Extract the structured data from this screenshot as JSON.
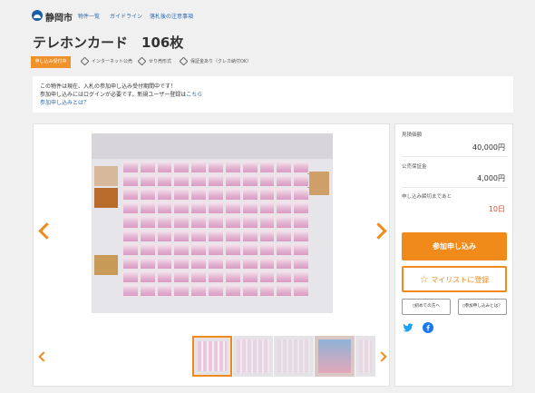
{
  "header": {
    "site_name": "静岡市",
    "nav": [
      "物件一覧",
      "ガイドライン",
      "落札後の注意事項"
    ]
  },
  "title": "テレホンカード　106枚",
  "tags": {
    "status_badge": "申し込み受付中",
    "items": [
      "インターネット公売",
      "せり売形式",
      "保証金あり（クレカ納付OK）"
    ]
  },
  "notice": {
    "line1": "この物件は現在、入札の参加申し込み受付期間中です！",
    "line2_pre": "参加申し込みにはログインが必要です。新規ユーザー登録は",
    "line2_link": "こちら",
    "line3_link": "参加申し込みとは？"
  },
  "panel": {
    "start_price_label": "見積価額",
    "start_price_value": "40,000円",
    "deposit_label": "公売保証金",
    "deposit_value": "4,000円",
    "time_left_label": "申し込み締切まであと",
    "time_left_value": "10日",
    "apply_button": "参加申し込み",
    "mylist_button": "マイリストに登録",
    "guide_button": "初めての方へ",
    "about_button": "参加申し込みとは？"
  },
  "colors": {
    "accent": "#f08a1a",
    "link": "#2a6ab3",
    "alert": "#e04a2a",
    "twitter": "#1da1f2",
    "facebook": "#1877f2"
  },
  "icons": [
    "shizuoka-logo-icon",
    "tag-icon",
    "chevron-left-icon",
    "chevron-right-icon",
    "star-icon",
    "document-icon",
    "twitter-icon",
    "facebook-icon"
  ]
}
